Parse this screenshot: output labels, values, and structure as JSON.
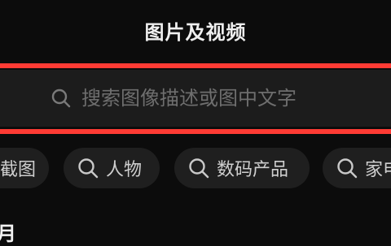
{
  "header": {
    "title": "图片及视频"
  },
  "search": {
    "placeholder": "搜索图像描述或图中文字"
  },
  "chips": [
    {
      "label": "截图",
      "icon": "none"
    },
    {
      "label": "人物",
      "icon": "search-icon"
    },
    {
      "label": "数码产品",
      "icon": "search-icon"
    },
    {
      "label": "家电",
      "icon": "search-icon"
    }
  ],
  "section": {
    "heading": "月"
  },
  "colors": {
    "background": "#0c0c0c",
    "highlight": "#ff3b34",
    "search_bg": "#1c1c1c",
    "chip_bg": "#1f1f1f"
  }
}
